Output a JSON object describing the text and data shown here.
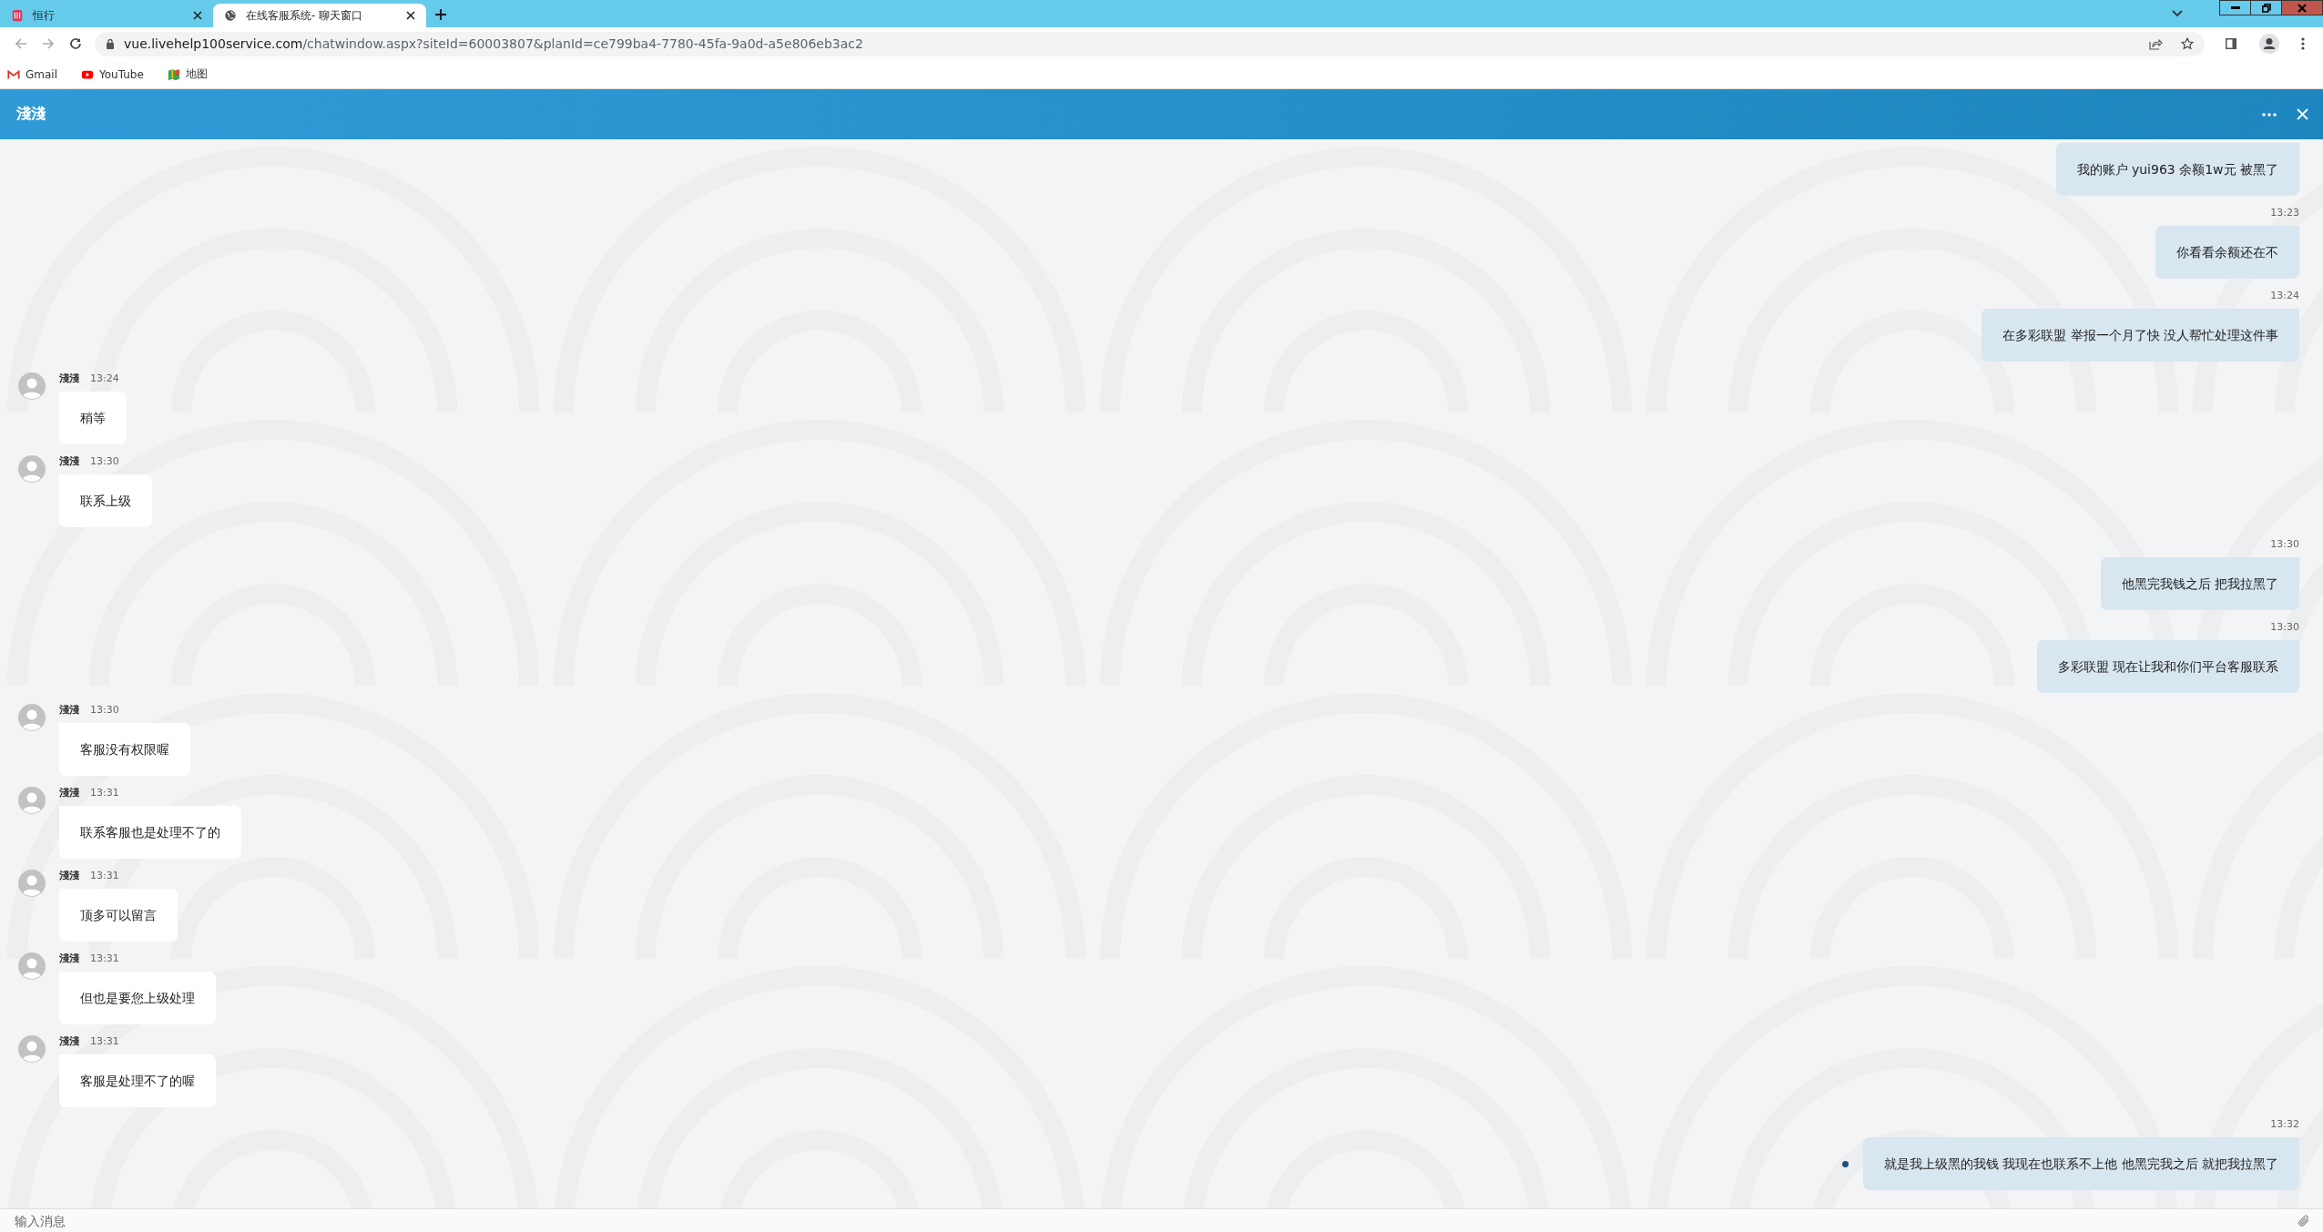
{
  "browser": {
    "tabs": [
      {
        "title": "恒行",
        "selected": false
      },
      {
        "title": "在线客服系统- 聊天窗口",
        "selected": true
      }
    ],
    "address": {
      "host": "vue.livehelp100service.com",
      "path": "/chatwindow.aspx?siteId=60003807&planId=ce799ba4-7780-45fa-9a0d-a5e806eb3ac2"
    },
    "bookmarks": [
      {
        "label": "Gmail"
      },
      {
        "label": "YouTube"
      },
      {
        "label": "地图"
      }
    ]
  },
  "chat": {
    "title": "淺淺",
    "messages": [
      {
        "kind": "outgoing",
        "text": "我的账户 yui963 余额1w元 被黑了",
        "status_dot": false
      },
      {
        "kind": "outgoing",
        "time": "13:23",
        "text": "你看看余额还在不",
        "status_dot": false
      },
      {
        "kind": "outgoing",
        "time": "13:24",
        "text": "在多彩联盟 举报一个月了快 没人帮忙处理这件事",
        "status_dot": false
      },
      {
        "kind": "incoming",
        "name": "淺淺",
        "time": "13:24",
        "text": "稍等"
      },
      {
        "kind": "incoming",
        "name": "淺淺",
        "time": "13:30",
        "text": "联系上级"
      },
      {
        "kind": "outgoing",
        "time": "13:30",
        "text": "他黑完我钱之后 把我拉黑了",
        "status_dot": false
      },
      {
        "kind": "outgoing",
        "time": "13:30",
        "text": "多彩联盟 现在让我和你们平台客服联系",
        "status_dot": false
      },
      {
        "kind": "incoming",
        "name": "淺淺",
        "time": "13:30",
        "text": "客服没有权限喔"
      },
      {
        "kind": "incoming",
        "name": "淺淺",
        "time": "13:31",
        "text": "联系客服也是处理不了的"
      },
      {
        "kind": "incoming",
        "name": "淺淺",
        "time": "13:31",
        "text": "顶多可以留言"
      },
      {
        "kind": "incoming",
        "name": "淺淺",
        "time": "13:31",
        "text": "但也是要您上级处理"
      },
      {
        "kind": "incoming",
        "name": "淺淺",
        "time": "13:31",
        "text": "客服是处理不了的喔"
      },
      {
        "kind": "outgoing",
        "time": "13:32",
        "text": "就是我上级黑的我钱 我现在也联系不上他 他黑完我之后 就把我拉黑了",
        "status_dot": true
      }
    ],
    "input": {
      "placeholder": "输入消息"
    }
  }
}
